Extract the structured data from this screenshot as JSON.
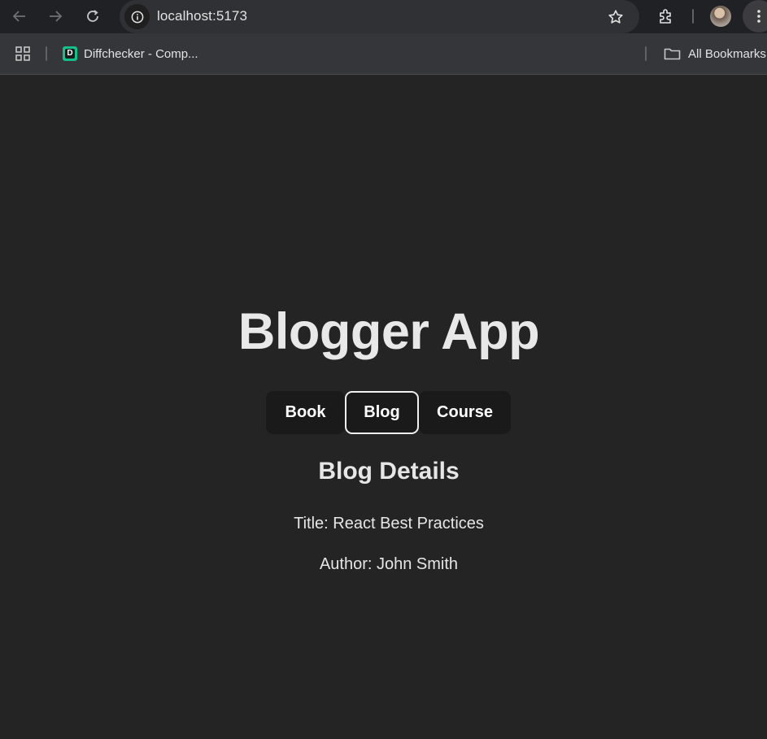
{
  "browser": {
    "url": "localhost:5173",
    "bookmarks": [
      {
        "label": "Diffchecker - Comp...",
        "favicon_letter": "D"
      }
    ],
    "all_bookmarks_label": "All Bookmarks"
  },
  "app": {
    "title": "Blogger App",
    "tabs": [
      {
        "label": "Book",
        "active": false
      },
      {
        "label": "Blog",
        "active": true
      },
      {
        "label": "Course",
        "active": false
      }
    ],
    "details": {
      "heading": "Blog Details",
      "title_line": "Title: React Best Practices",
      "author_line": "Author: John Smith"
    }
  },
  "colors": {
    "page_background": "#242424",
    "tab_background": "#1a1a1a",
    "active_tab_border": "#f0f0f0",
    "text": "#e8e8e8"
  }
}
